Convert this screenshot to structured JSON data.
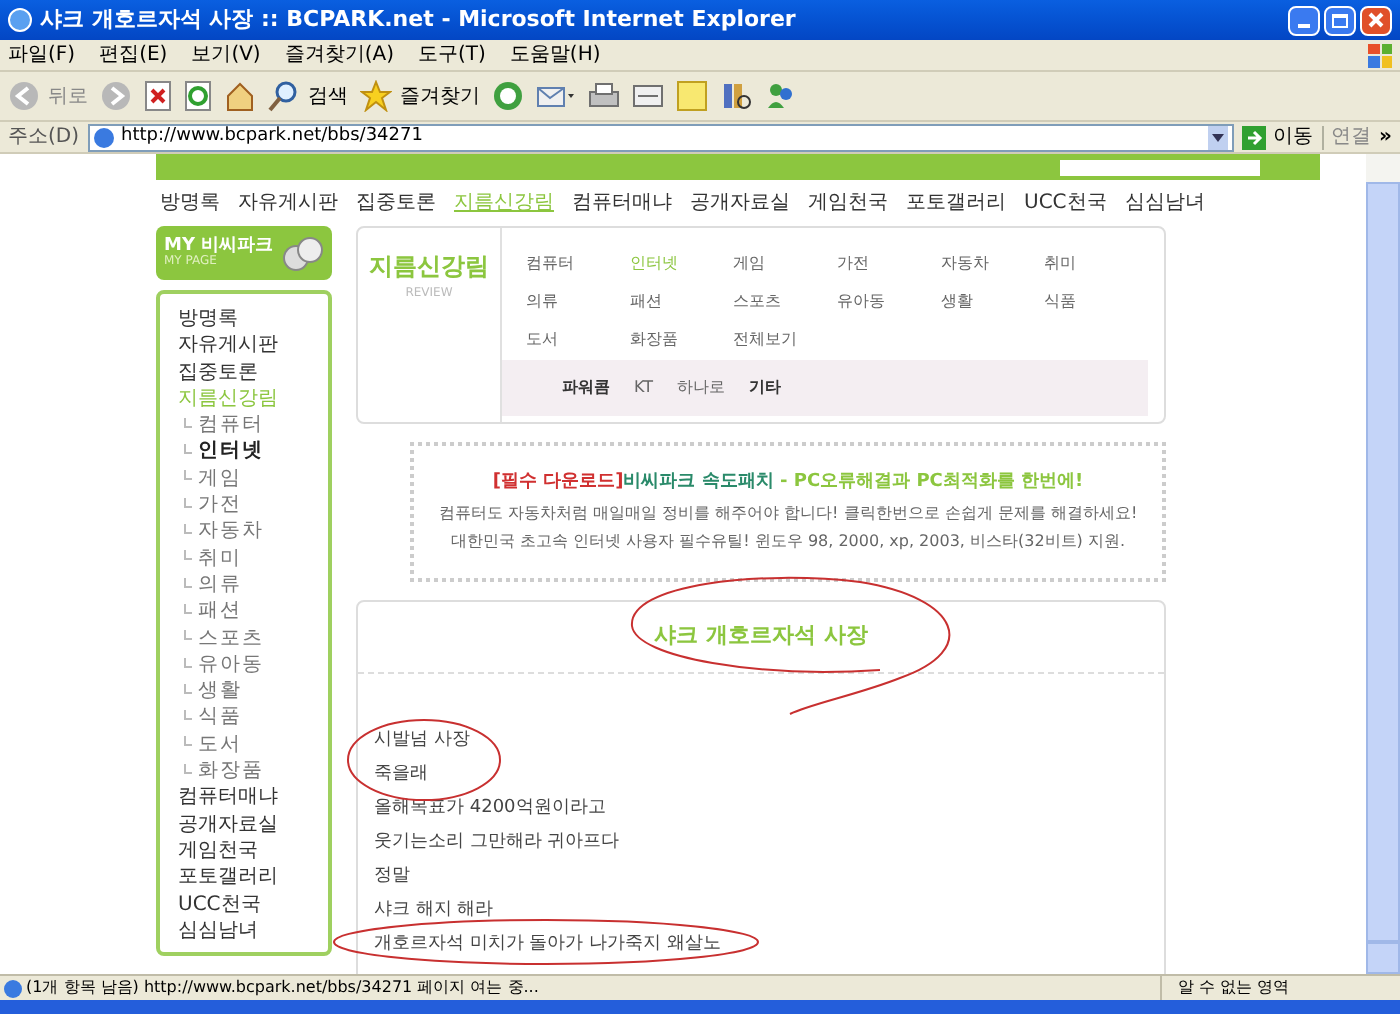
{
  "window": {
    "title": "샤크 개호르자석 사장 :: BCPARK.net - Microsoft Internet Explorer"
  },
  "menu_bar": [
    "파일(F)",
    "편집(E)",
    "보기(V)",
    "즐겨찾기(A)",
    "도구(T)",
    "도움말(H)"
  ],
  "toolbar": {
    "back": "뒤로",
    "search": "검색",
    "favorites": "즐겨찾기"
  },
  "address_bar": {
    "label": "주소(D)",
    "value": "http://www.bcpark.net/bbs/34271",
    "go": "이동",
    "links": "연결",
    "more": "»"
  },
  "nav": [
    {
      "label": "방명록",
      "selected": false
    },
    {
      "label": "자유게시판",
      "selected": false
    },
    {
      "label": "집중토론",
      "selected": false
    },
    {
      "label": "지름신강림",
      "selected": true
    },
    {
      "label": "컴퓨터매냐",
      "selected": false
    },
    {
      "label": "공개자료실",
      "selected": false
    },
    {
      "label": "게임천국",
      "selected": false
    },
    {
      "label": "포토갤러리",
      "selected": false
    },
    {
      "label": "UCC천국",
      "selected": false
    },
    {
      "label": "심심남녀",
      "selected": false
    }
  ],
  "my_page": {
    "title": "MY 비씨파크",
    "subtitle": "MY PAGE"
  },
  "sidebar": {
    "items": [
      {
        "label": "방명록",
        "selected": false
      },
      {
        "label": "자유게시판",
        "selected": false
      },
      {
        "label": "집중토론",
        "selected": false
      },
      {
        "label": "지름신강림",
        "selected": true,
        "children": [
          {
            "label": "컴퓨터",
            "selected": false
          },
          {
            "label": "인터넷",
            "selected": true
          },
          {
            "label": "게임",
            "selected": false
          },
          {
            "label": "가전",
            "selected": false
          },
          {
            "label": "자동차",
            "selected": false
          },
          {
            "label": "취미",
            "selected": false
          },
          {
            "label": "의류",
            "selected": false
          },
          {
            "label": "패션",
            "selected": false
          },
          {
            "label": "스포츠",
            "selected": false
          },
          {
            "label": "유아동",
            "selected": false
          },
          {
            "label": "생활",
            "selected": false
          },
          {
            "label": "식품",
            "selected": false
          },
          {
            "label": "도서",
            "selected": false
          },
          {
            "label": "화장품",
            "selected": false
          }
        ]
      },
      {
        "label": "컴퓨터매냐",
        "selected": false
      },
      {
        "label": "공개자료실",
        "selected": false
      },
      {
        "label": "게임천국",
        "selected": false
      },
      {
        "label": "포토갤러리",
        "selected": false
      },
      {
        "label": "UCC천국",
        "selected": false
      },
      {
        "label": "심심남녀",
        "selected": false
      }
    ]
  },
  "category_panel": {
    "title": "지름신강림",
    "subtitle": "REVIEW",
    "categories": [
      {
        "label": "컴퓨터",
        "selected": false
      },
      {
        "label": "인터넷",
        "selected": true
      },
      {
        "label": "게임",
        "selected": false
      },
      {
        "label": "가전",
        "selected": false
      },
      {
        "label": "자동차",
        "selected": false
      },
      {
        "label": "취미",
        "selected": false
      },
      {
        "label": "의류",
        "selected": false
      },
      {
        "label": "패션",
        "selected": false
      },
      {
        "label": "스포츠",
        "selected": false
      },
      {
        "label": "유아동",
        "selected": false
      },
      {
        "label": "생활",
        "selected": false
      },
      {
        "label": "식품",
        "selected": false
      },
      {
        "label": "도서",
        "selected": false
      },
      {
        "label": "화장품",
        "selected": false
      },
      {
        "label": "전체보기",
        "selected": false
      }
    ],
    "isp": [
      {
        "label": "파워콤",
        "bold": true
      },
      {
        "label": "KT",
        "bold": false
      },
      {
        "label": "하나로",
        "bold": false
      },
      {
        "label": "기타",
        "bold": true
      }
    ]
  },
  "ad": {
    "headline": [
      {
        "kind": "tag",
        "text": "[필수 다운로드]"
      },
      {
        "kind": "product",
        "text": "비씨파크 속도패치"
      },
      {
        "kind": "plain",
        "text": " - PC오류해결과 PC최적화를 한번에!"
      }
    ],
    "lines": [
      "컴퓨터도 자동차처럼 매일매일 정비를 해주어야 합니다! 클릭한번으로 손쉽게 문제를 해결하세요!",
      "대한민국 초고속 인터넷 사용자 필수유틸! 윈도우 98, 2000, xp, 2003, 비스타(32비트) 지원."
    ]
  },
  "post": {
    "title": "샤크 개호르자석 사장",
    "body": [
      "시발넘 사장",
      "죽을래",
      "올해목표가 4200억원이라고",
      "웃기는소리 그만해라 귀아프다",
      "정말",
      "샤크 해지 해라",
      "개호르자석 미치가 돌아가 나가죽지 왜살노"
    ]
  },
  "status_bar": {
    "message": "(1개 항목 남음) http://www.bcpark.net/bbs/34271 페이지 여는 중...",
    "zone": "알 수 없는 영역"
  }
}
